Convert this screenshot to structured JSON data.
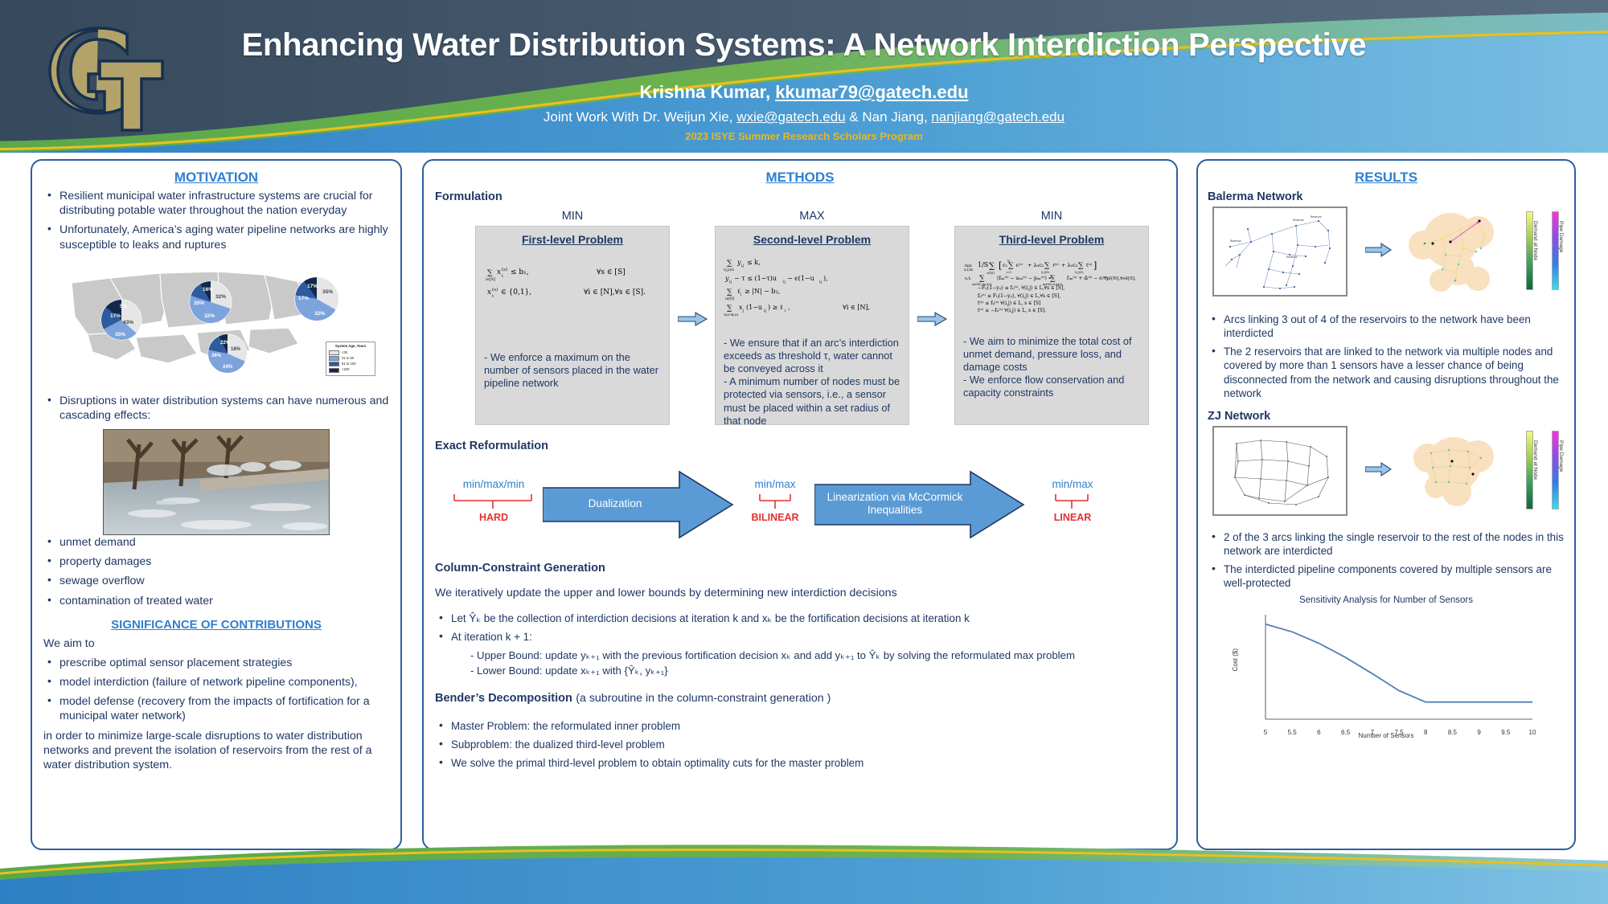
{
  "header": {
    "title": "Enhancing Water Distribution Systems: A Network Interdiction Perspective",
    "author_prefix": "Krishna Kumar, ",
    "author_email": "kkumar79@gatech.edu",
    "joint_prefix": "Joint Work With Dr. Weijun Xie, ",
    "joint_email1": "wxie@gatech.edu",
    "joint_mid": " & Nan Jiang, ",
    "joint_email2": "nanjiang@gatech.edu",
    "program": "2023 ISYE Summer Research Scholars Program",
    "logo_alt": "gt-logo"
  },
  "motivation": {
    "title": "MOTIVATION",
    "bullets": [
      "Resilient municipal water infrastructure systems are crucial for distributing potable water throughout the nation everyday",
      "Unfortunately, America’s aging water pipeline networks are highly susceptible to leaks and ruptures"
    ],
    "map": {
      "legend_title": "System Age, Years",
      "legend_items": [
        {
          "label": "<30",
          "color": "#e6e6e6"
        },
        {
          "label": "31 to 60",
          "color": "#7da3dd"
        },
        {
          "label": "61 to 100",
          "color": "#2d5b9e"
        },
        {
          "label": ">100",
          "color": "#12284c"
        }
      ],
      "pies": [
        {
          "name": "west",
          "values": [
            "17%",
            "5%",
            "43%",
            "35%"
          ]
        },
        {
          "name": "midwest",
          "values": [
            "16%",
            "20%",
            "32%",
            "32%"
          ]
        },
        {
          "name": "northeast",
          "values": [
            "17%",
            "17%",
            "35%",
            "32%"
          ]
        },
        {
          "name": "south",
          "values": [
            "22%",
            "36%",
            "24%",
            "18%"
          ]
        }
      ]
    },
    "disruption_bullet": "Disruptions in water distribution systems can have numerous and cascading effects:",
    "effects": [
      "unmet demand",
      "property damages",
      "sewage overflow",
      "contamination of treated water"
    ],
    "significance_title": "SIGNIFICANCE OF CONTRIBUTIONS",
    "we_aim_to": "We aim to",
    "aims": [
      "prescribe optimal sensor placement strategies",
      "model interdiction (failure of network pipeline components),",
      "model defense (recovery from the impacts of fortification for a municipal water network)"
    ],
    "closing": "in order to minimize large-scale disruptions to water distribution networks and prevent the isolation of reservoirs from the rest of a water distribution system."
  },
  "methods": {
    "title": "METHODS",
    "formulation_label": "Formulation",
    "levels": [
      {
        "objective": "MIN",
        "heading": "First-level Problem",
        "equations": [
          "∑_{i∈[N]} xᵢ^(s) ≤ b₁,          ∀s ∈ [S]",
          "xᵢ^(s) ∈ {0,1},            ∀i ∈ [N],∀s ∈ [S]."
        ],
        "description": "- We enforce a maximum on the number of sensors placed in the water pipeline network"
      },
      {
        "objective": "MAX",
        "heading": "Second-level Problem",
        "equations": [
          "∑_{(i,j)∈L} yᵢⱼ ≤ k,",
          "yᵢⱼ − τ ≤ (1−τ)uᵢⱼ − ϵ(1−uᵢⱼ),",
          "∑_{i∈[N]} ℓᵢ ≥ |N| − b₂,",
          "∑_{j∈N(i)∩Bᵣ(i)} xⱼ(1−uᵢⱼ) ≥ ℓᵢ,          ∀i ∈ [N],"
        ],
        "description": "- We ensure that if an arc’s interdiction exceeds as threshold τ, water cannot be conveyed across it\n- A minimum number of nodes must be protected via sensors, i.e., a sensor must be placed within a set radius of that node"
      },
      {
        "objective": "MIN",
        "heading": "Third-level Problem",
        "equations": [
          "min_{x,f,m} (1/S) ∑_{s∈[S]} [ c₁ ∑_{i=1}^{N} ℓᵢ^(s) + λ₀c₂ ∑_{(i,j)∈L} ℓ^(s) + λ₀c₃ ∑_{(i,j)∈L} t^(s) ]",
          "s.t.  ∑_{m∈N(i),(m,i)∈L} (fᵢₘ^(s) − uᵢₘ^(s) − pᵢₘ^(s)) = ∑_{m∈N(i),(i,m)∈L} fⱼₘ^(s) + dᵢ^(s) − eᵢ^(s),   ∀j ∈ [N],∀s ∈ [S],",
          "−Fᵢⱼ(1−yᵢⱼ) ≤ fᵢⱼ^(s),   ∀(i,j) ∈ L,∀s ∈ [S],",
          "fᵢⱼ^(s) ≤ Fᵢⱼ(1−yᵢⱼ),   ∀(i,j) ∈ L,∀s ∈ [S],",
          "t^(s) ≤ fᵢⱼ^(s)   ∀(i,j) ∈ L, s ∈ [S]",
          "t^(s) ≥ −fᵢⱼ^(s)   ∀(i,j) ∈ L, s ∈ [S]."
        ],
        "description": "- We aim to minimize the total cost of unmet demand, pressure loss, and damage costs\n- We enforce flow conservation and capacity constraints"
      }
    ],
    "reformulation_label": "Exact Reformulation",
    "reform_stages": [
      {
        "minmax": "min/max/min",
        "tag": "HARD"
      },
      {
        "minmax": "min/max",
        "tag": "BILINEAR"
      },
      {
        "minmax": "min/max",
        "tag": "LINEAR"
      }
    ],
    "reform_arrows": [
      {
        "label": "Dualization"
      },
      {
        "label": "Linearization via McCormick Inequalities"
      }
    ],
    "ccg_title": "Column-Constraint Generation",
    "ccg_intro": "We iteratively update the upper and lower bounds by determining new interdiction decisions",
    "ccg_bullets": [
      "Let Ŷₖ be the collection of interdiction decisions at iteration k and xₖ be the fortification decisions at iteration k",
      "At iteration k + 1:"
    ],
    "ccg_sub": [
      "- Upper Bound: update yₖ₊₁ with the previous fortification decision xₖ and add yₖ₊₁ to Ŷₖ by solving the reformulated max problem",
      "- Lower Bound: update xₖ₊₁ with {Ŷₖ, yₖ₊₁}"
    ],
    "benders_title": "Bender’s Decomposition",
    "benders_sub": "(a subroutine in the column-constraint generation )",
    "benders_bullets": [
      "Master Problem: the reformulated inner problem",
      "Subproblem: the dualized third-level problem",
      "We solve the primal third-level problem to obtain optimality cuts for the master problem"
    ]
  },
  "results": {
    "title": "RESULTS",
    "networks": [
      {
        "name": "Balerma Network",
        "colorbar_labels": [
          "Demand at Node",
          "Pipe Damage"
        ],
        "bullets": [
          "Arcs linking 3 out of 4 of the reservoirs to the network have been interdicted",
          "The 2 reservoirs that are linked to the network via multiple nodes and covered by more than 1 sensors have a lesser chance of being disconnected from the network and causing disruptions throughout the network"
        ]
      },
      {
        "name": "ZJ Network",
        "colorbar_labels": [
          "Demand at Node",
          "Pipe Damage"
        ],
        "bullets": [
          "2 of the 3 arcs linking the single reservoir to the rest of the nodes in this network are interdicted",
          "The interdicted pipeline components covered by multiple sensors are well-protected"
        ]
      }
    ]
  },
  "chart_data": {
    "type": "line",
    "title": "Sensitivity Analysis for Number of Sensors",
    "xlabel": "Number of Sensors",
    "ylabel": "Cost ($)",
    "x": [
      5,
      5.5,
      6,
      6.5,
      7,
      7.5,
      8,
      8.5,
      9,
      9.5,
      10
    ],
    "values": [
      100,
      92,
      80,
      65,
      48,
      30,
      18,
      18,
      18,
      18,
      18
    ],
    "xticks": [
      "5",
      "5.5",
      "6",
      "6.5",
      "7",
      "7.5",
      "8",
      "8.5",
      "9",
      "9.5",
      "10"
    ],
    "xlim": [
      5,
      10
    ],
    "ylim": [
      0,
      110
    ],
    "grid": false,
    "legend": "none",
    "series_color": "#4f7fb5"
  },
  "colors": {
    "accent_blue": "#2f7fd0",
    "dark_navy": "#1f3864",
    "gt_gold": "#b3a369",
    "red": "#e03131",
    "arrow_blue": "#5b9bd5"
  }
}
